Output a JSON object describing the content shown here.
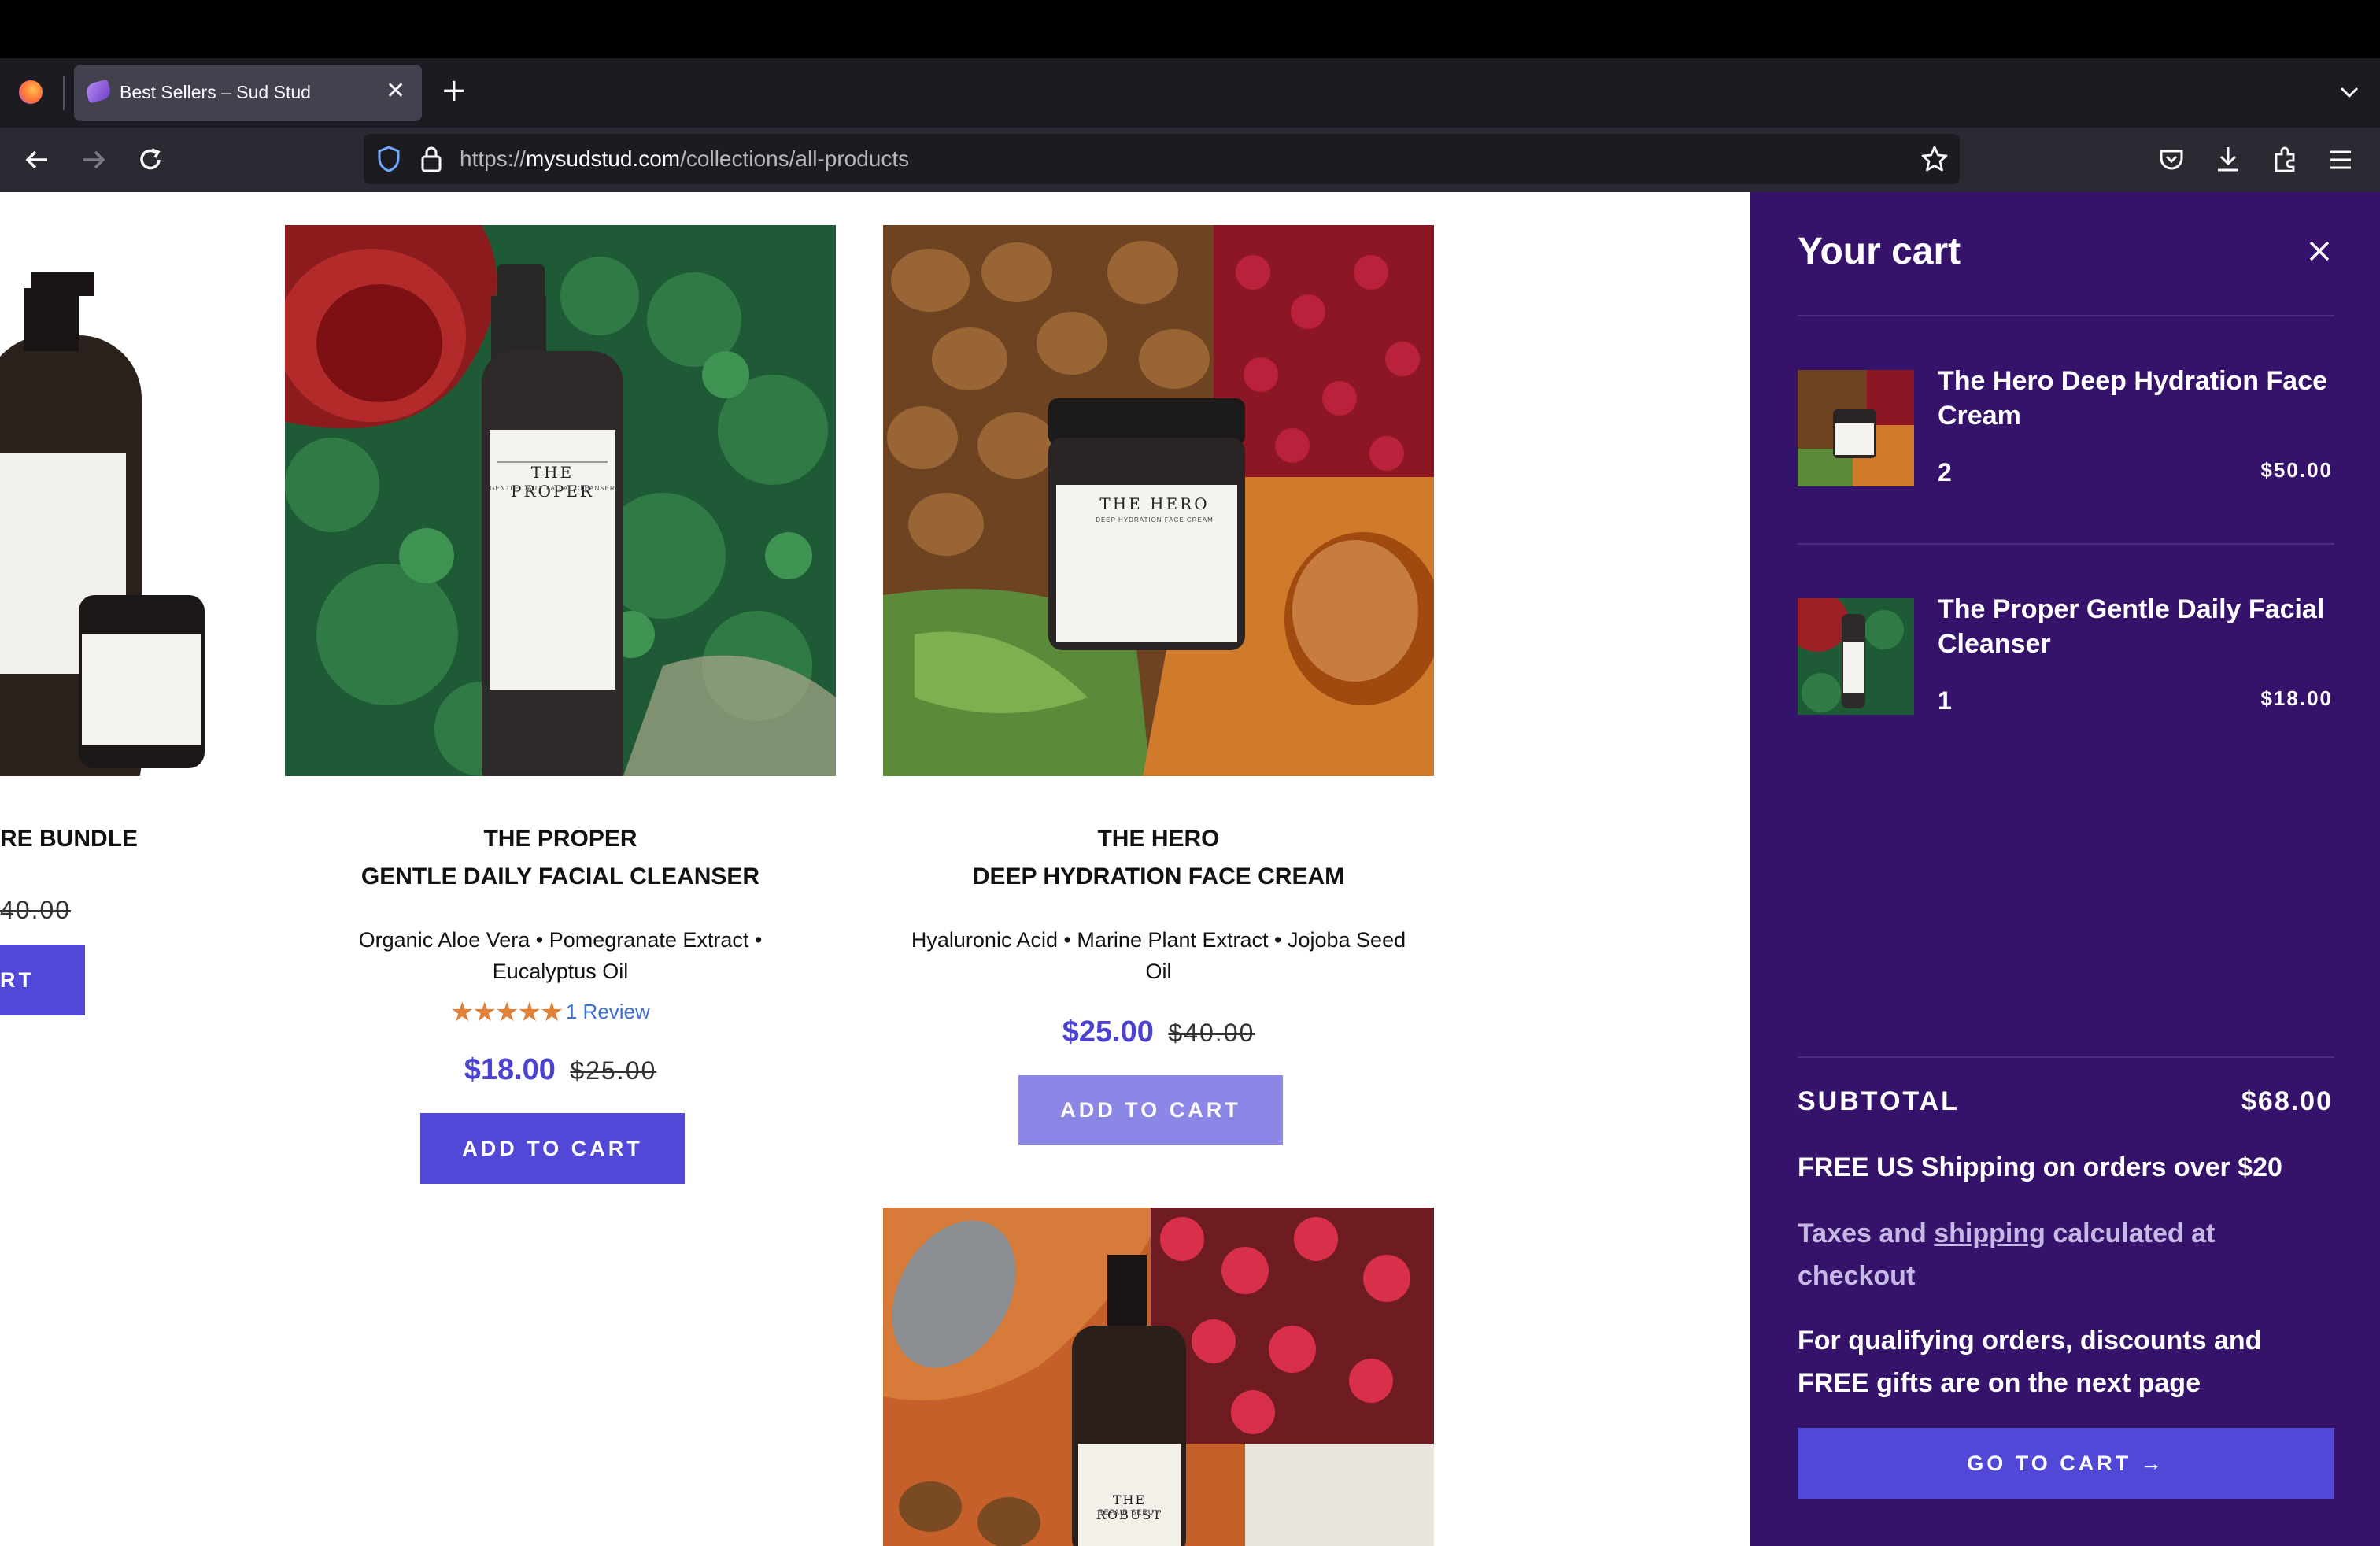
{
  "browser": {
    "tab_title": "Best Sellers – Sud Stud",
    "url_prefix": "https://",
    "url_domain": "mysudstud.com",
    "url_path": "/collections/all-products"
  },
  "products": {
    "partial": {
      "title": "RE BUNDLE",
      "old_price": "40.00",
      "button": "RT"
    },
    "proper": {
      "title_line1": "THE PROPER",
      "title_line2": "GENTLE DAILY FACIAL CLEANSER",
      "description": "Organic Aloe Vera • Pomegranate Extract • Eucalyptus Oil",
      "rating": 5,
      "review_text": "1 Review",
      "sale_price": "$18.00",
      "old_price": "$25.00",
      "button": "ADD TO CART",
      "bottle_label": "THE PROPER",
      "bottle_sub": "GENTLE DAILY FACIAL CLEANSER"
    },
    "hero": {
      "title_line1": "THE HERO",
      "title_line2": "DEEP HYDRATION FACE CREAM",
      "description": "Hyaluronic Acid • Marine Plant Extract • Jojoba Seed Oil",
      "sale_price": "$25.00",
      "old_price": "$40.00",
      "button": "ADD TO CART",
      "jar_label": "THE HERO",
      "jar_sub": "DEEP HYDRATION FACE CREAM"
    },
    "robust": {
      "bottle_label": "THE ROBUST",
      "bottle_sub": "REPAIR SERUM"
    }
  },
  "cart": {
    "title": "Your cart",
    "items": [
      {
        "name": "The Hero Deep Hydration Face Cream",
        "qty": "2",
        "price": "$50.00"
      },
      {
        "name": "The Proper Gentle Daily Facial Cleanser",
        "qty": "1",
        "price": "$18.00"
      }
    ],
    "subtotal_label": "SUBTOTAL",
    "subtotal_value": "$68.00",
    "shipping_note": "FREE US Shipping on orders over $20",
    "taxes_before": "Taxes and ",
    "taxes_link": "shipping",
    "taxes_after": " calculated at checkout",
    "qualifying_note": "For qualifying orders, discounts and FREE gifts are on the next page",
    "checkout_button": "GO TO CART →"
  },
  "colors": {
    "accent": "#5148d8",
    "drawer_bg": "#35136a",
    "star": "#e0813a"
  }
}
